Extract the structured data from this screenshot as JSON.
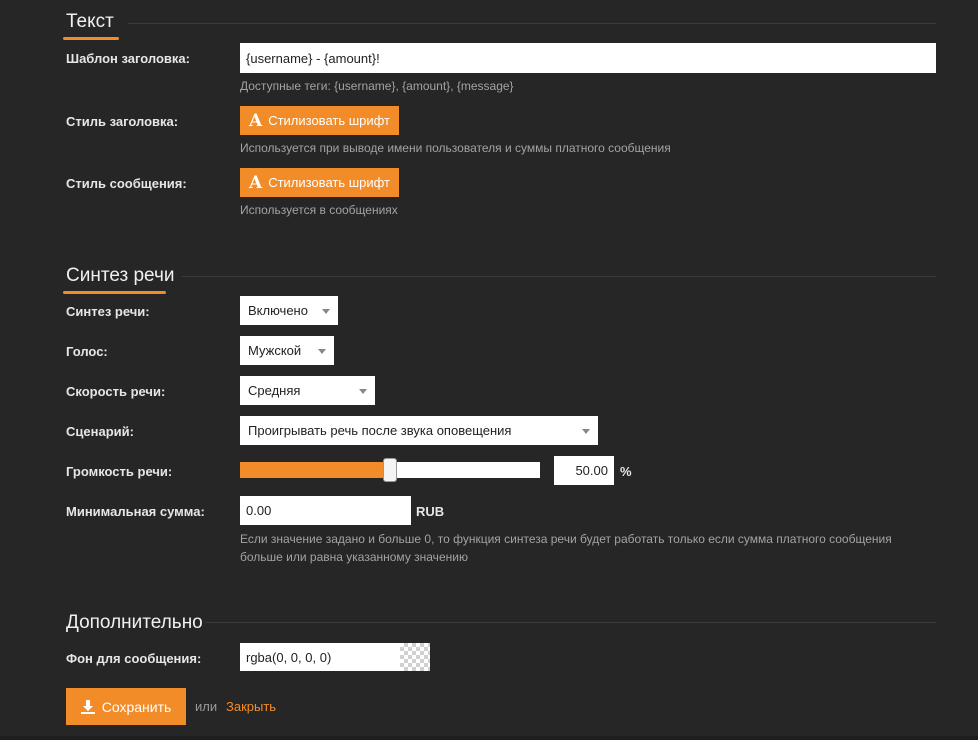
{
  "sections": {
    "text": "Текст",
    "speech": "Синтез речи",
    "extra": "Дополнительно"
  },
  "text_section": {
    "title_template_label": "Шаблон заголовка:",
    "title_template_value": "{username} - {amount}!",
    "title_template_hint": "Доступные теги: {username}, {amount}, {message}",
    "title_style_label": "Стиль заголовка:",
    "style_button_label": "Стилизовать шрифт",
    "title_style_hint": "Используется при выводе имени пользователя и суммы платного сообщения",
    "message_style_label": "Стиль сообщения:",
    "message_style_hint": "Используется в сообщениях"
  },
  "speech_section": {
    "tts_label": "Синтез речи:",
    "tts_value": "Включено",
    "voice_label": "Голос:",
    "voice_value": "Мужской",
    "rate_label": "Скорость речи:",
    "rate_value": "Средняя",
    "scenario_label": "Сценарий:",
    "scenario_value": "Проигрывать речь после звука оповещения",
    "volume_label": "Громкость речи:",
    "volume_value": "50.00",
    "volume_fraction": 0.5,
    "volume_unit": "%",
    "min_amount_label": "Минимальная сумма:",
    "min_amount_value": "0.00",
    "currency": "RUB",
    "min_amount_hint_1": "Если значение задано и больше 0, то функция синтеза речи будет работать только если сумма платного сообщения",
    "min_amount_hint_2": "больше или равна указанному значению"
  },
  "extra_section": {
    "bg_label": "Фон для сообщения:",
    "bg_value": "rgba(0, 0, 0, 0)"
  },
  "footer": {
    "save_label": "Сохранить",
    "or_text": "или",
    "close_label": "Закрыть"
  },
  "colors": {
    "accent": "#f28c28",
    "background": "#262626"
  }
}
